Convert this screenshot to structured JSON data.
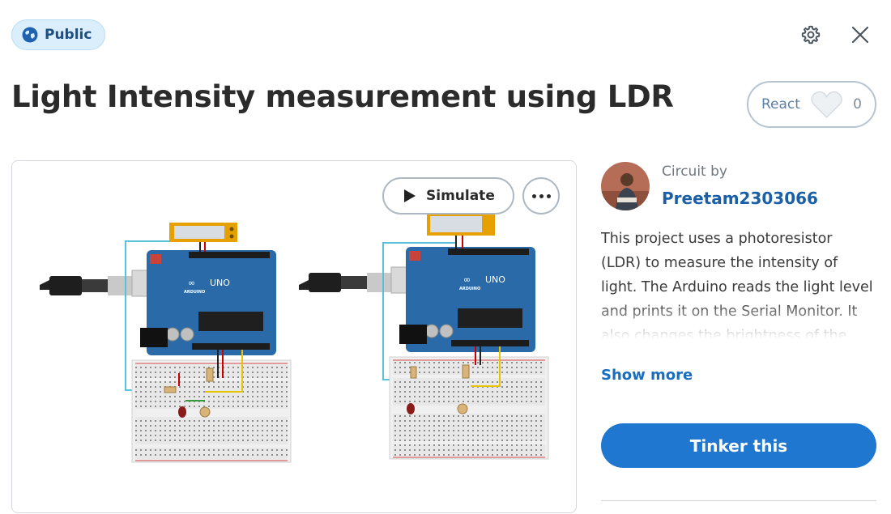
{
  "visibility": {
    "label": "Public",
    "icon": "globe-icon"
  },
  "header": {
    "settings_icon": "gear-icon",
    "close_icon": "close-icon"
  },
  "project": {
    "title": "Light Intensity measurement using LDR"
  },
  "react": {
    "label": "React",
    "count": "0",
    "icon": "heart-icon"
  },
  "canvas": {
    "simulate_label": "Simulate",
    "simulate_icon": "play-icon",
    "more_icon": "more-options-icon",
    "board_label": "UNO",
    "board_brand": "ARDUINO"
  },
  "author": {
    "prefix": "Circuit by",
    "name": "Preetam2303066"
  },
  "description": "This project uses a photoresistor (LDR) to measure the intensity of light. The Arduino reads the light level and prints it on the Serial Monitor. It also changes the brightness of the LED based on light.",
  "show_more": "Show more",
  "tinker_label": "Tinker this",
  "colors": {
    "accent": "#1f77d0",
    "badge_bg": "#dbeefc",
    "board": "#2b6aa8"
  }
}
